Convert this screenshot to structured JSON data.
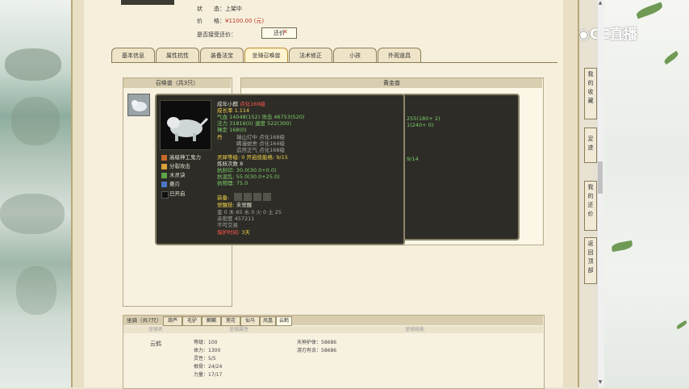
{
  "listing": {
    "status_label": "状　　态：",
    "status_value": "上架中",
    "price_label": "价　　格：",
    "price_value": "¥1100.00 (元)",
    "offer_label": "是否接受还价：",
    "offer_button": "还价",
    "offer_close": "✕"
  },
  "tabs": [
    "基本信息",
    "属性抗性",
    "装备法宝",
    "坐骑召唤兽",
    "法术修正",
    "小孩",
    "外观道具"
  ],
  "active_tab": 3,
  "pet_panel": {
    "header": "召唤兽（共3只）"
  },
  "detail_panel": {
    "header": "黄金兽"
  },
  "tooltip": {
    "name": "成年小麒",
    "name_tag": "点化169级",
    "growth": "成长率 1.114",
    "hp": "气血 14048",
    "hp_bonus": "(152)",
    "atk": "攻击 46753",
    "atk_bonus": "(520)",
    "mp": "法力 31816",
    "mp_bonus": "(0)",
    "spd": "速度 522",
    "spd_bonus": "(300)",
    "focus": "禅定 168",
    "focus_bonus": "(0)",
    "dan_label": "丹",
    "dan1": "瑞山灯中 点化168级",
    "dan2": "瞒漫蜕舍 点化164级",
    "dan3": "造然正气 点化168级",
    "skills": [
      "高级神工鬼力",
      "分裂攻击",
      "木灵诀",
      "悬刃",
      "已开启"
    ],
    "spirit_level": "灵犀等级:",
    "spirit_value": "0 开启技能格: 9/15",
    "train": "炼妖次数 8",
    "res1": "抗封印: 30.0(30.0+0.0)",
    "res2": "抗混乱: 55.0(30.0+25.0)",
    "res3": "抗物理: 75.0",
    "equip_label": "装备:",
    "awaken_label": "觉醒技:",
    "awaken_value": "未觉醒",
    "elements": "金 0 木 65 水 0 火 0 土 25",
    "intimacy": "亲密度 457211",
    "trade": "不可交易",
    "protect_label": "保护时间:",
    "protect_value": "3天"
  },
  "tooltip2": {
    "line1": "255(180+ 2)",
    "line2": "1(240+ 0)",
    "line3": "9/14"
  },
  "mount": {
    "header": "坐骑（共7只）",
    "tabs": [
      "葫芦",
      "毛驴",
      "麒麟",
      "莲花",
      "仙马",
      "凤凰",
      "云鹤"
    ],
    "active_tab": 6,
    "sub_headers": [
      "坐骑名",
      "坐骑属性",
      "坐骑技能"
    ],
    "name": "云鹤",
    "attrs": [
      "等级：100",
      "体力：1300",
      "灵性：5/5",
      "根骨：24/24",
      "力量：17/17"
    ],
    "skills": [
      "天神护体：58686",
      "游刃有余：58686"
    ]
  },
  "side_nav": [
    "我的收藏",
    "足迹",
    "我的还价",
    "返回顶部"
  ],
  "logo_text": "CC直播",
  "scroll_up": "▲",
  "scroll_down": "▼"
}
